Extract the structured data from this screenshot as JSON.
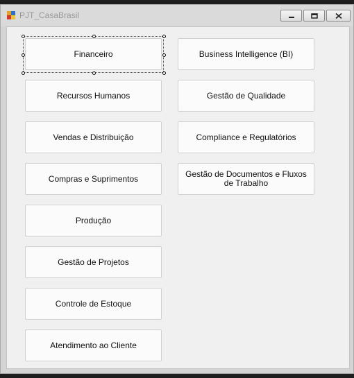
{
  "window": {
    "title": "PJT_CasaBrasil",
    "controls": {
      "minimize_icon": "minimize-icon",
      "maximize_icon": "maximize-icon",
      "close_icon": "close-icon"
    }
  },
  "modules": {
    "left": [
      "Financeiro",
      "Recursos Humanos",
      "Vendas e Distribuição",
      "Compras e Suprimentos",
      "Produção",
      "Gestão de Projetos",
      "Controle de Estoque",
      "Atendimento ao Cliente"
    ],
    "right": [
      "Business Intelligence (BI)",
      "Gestão de Qualidade",
      "Compliance e Regulatórios",
      "Gestão de Documentos e Fluxos de Trabalho"
    ]
  },
  "selected_module": "Financeiro"
}
